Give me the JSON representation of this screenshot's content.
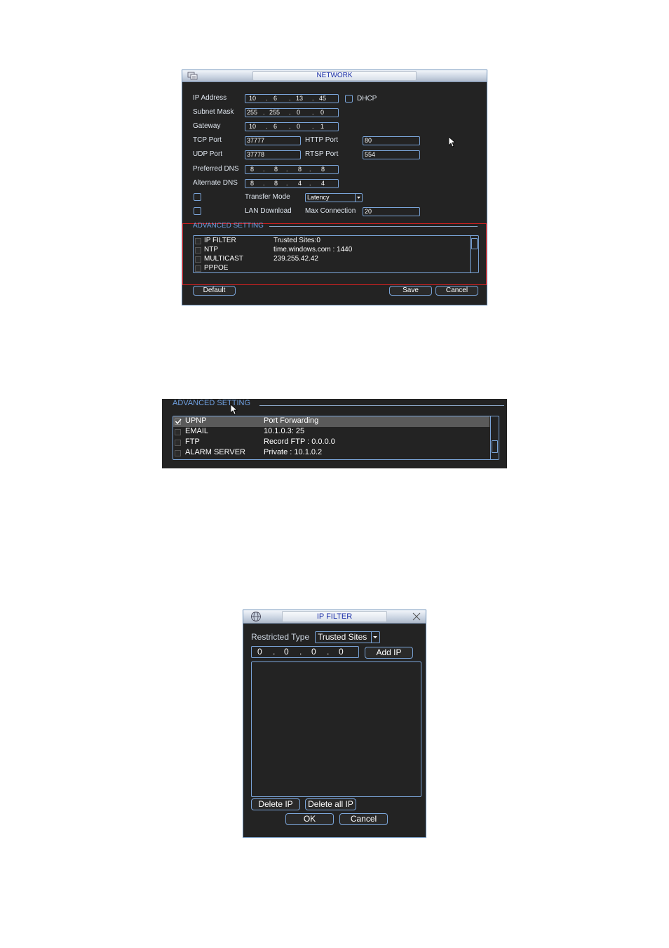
{
  "network": {
    "title": "NETWORK",
    "labels": {
      "ip_address": "IP Address",
      "subnet_mask": "Subnet Mask",
      "gateway": "Gateway",
      "tcp_port": "TCP Port",
      "udp_port": "UDP Port",
      "preferred_dns": "Preferred DNS",
      "alternate_dns": "Alternate DNS",
      "http_port": "HTTP Port",
      "rtsp_port": "RTSP Port",
      "dhcp": "DHCP",
      "transfer_mode": "Transfer Mode",
      "lan_download": "LAN Download",
      "max_connection": "Max Connection"
    },
    "ip_address": [
      "10",
      "6",
      "13",
      "45"
    ],
    "subnet_mask": [
      "255",
      "255",
      "0",
      "0"
    ],
    "gateway": [
      "10",
      "6",
      "0",
      "1"
    ],
    "tcp_port": "37777",
    "udp_port": "37778",
    "http_port": "80",
    "rtsp_port": "554",
    "preferred_dns": [
      "8",
      "8",
      "8",
      "8"
    ],
    "alternate_dns": [
      "8",
      "8",
      "4",
      "4"
    ],
    "transfer_mode_value": "Latency",
    "max_connection_value": "20",
    "advanced_title": "ADVANCED SETTING",
    "advanced_rows": [
      {
        "name": "IP FILTER",
        "value": "Trusted Sites:0"
      },
      {
        "name": "NTP",
        "value": "time.windows.com : 1440"
      },
      {
        "name": "MULTICAST",
        "value": "239.255.42.42"
      },
      {
        "name": "PPPOE",
        "value": ""
      }
    ],
    "buttons": {
      "default": "Default",
      "save": "Save",
      "cancel": "Cancel"
    },
    "colors": {
      "highlight_box": "#d42020",
      "accent": "#6fa0e0"
    }
  },
  "advanced_zoom": {
    "title": "ADVANCED SETTING",
    "rows": [
      {
        "name": "UPNP",
        "value": "Port Forwarding",
        "checked": true
      },
      {
        "name": "EMAIL",
        "value": "10.1.0.3: 25",
        "checked": false
      },
      {
        "name": "FTP",
        "value": "Record FTP : 0.0.0.0",
        "checked": false
      },
      {
        "name": "ALARM SERVER",
        "value": "Private : 10.1.0.2",
        "checked": false
      }
    ]
  },
  "ip_filter": {
    "title": "IP FILTER",
    "restricted_type_label": "Restricted Type",
    "restricted_type_value": "Trusted Sites",
    "ip": [
      "0",
      "0",
      "0",
      "0"
    ],
    "buttons": {
      "add_ip": "Add IP",
      "delete_ip": "Delete IP",
      "delete_all_ip": "Delete all IP",
      "ok": "OK",
      "cancel": "Cancel"
    }
  }
}
